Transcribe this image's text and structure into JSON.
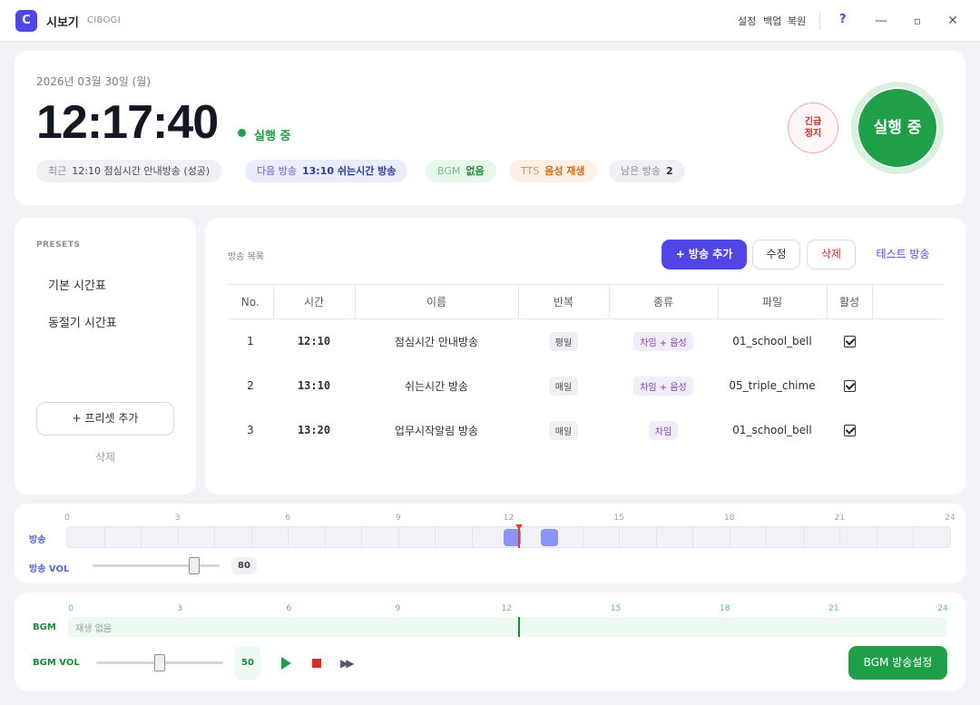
{
  "titlebar": {
    "logo_letter": "C",
    "app_name": "시보기",
    "app_sub": "CIBOGI",
    "menu": [
      "설정",
      "백업",
      "복원"
    ],
    "help": "?",
    "minimize": "—",
    "maximize": "▫",
    "close": "✕"
  },
  "status": {
    "date": "2026년 03월 30일 (월)",
    "clock": "12:17:40",
    "state": "실행 중",
    "chips": {
      "recent_key": "최근",
      "recent_val": "12:10 점심시간 안내방송 (성공)",
      "next_key": "다음 방송",
      "next_val": "13:10 쉬는시간 방송",
      "bgm_key": "BGM",
      "bgm_val": "없음",
      "tts_key": "TTS",
      "tts_val": "음성 재생",
      "remain_key": "남은 방송",
      "remain_val": "2"
    },
    "emergency_line1": "긴급",
    "emergency_line2": "정지",
    "run_button": "실행 중"
  },
  "presets": {
    "title": "PRESETS",
    "items": [
      "기본 시간표",
      "동절기 시간표"
    ],
    "add_label": "+ 프리셋 추가",
    "delete_label": "삭제"
  },
  "schedule": {
    "title": "방송 목록",
    "add_label": "+ 방송 추가",
    "edit_label": "수정",
    "delete_label": "삭제",
    "test_label": "테스트 방송",
    "columns": [
      "No.",
      "시간",
      "이름",
      "반복",
      "종류",
      "파일",
      "활성"
    ],
    "rows": [
      {
        "no": "1",
        "time": "12:10",
        "name": "점심시간 안내방송",
        "repeat": "평일",
        "type": "차임 + 음성",
        "file": "01_school_bell",
        "active": true
      },
      {
        "no": "2",
        "time": "13:10",
        "name": "쉬는시간 방송",
        "repeat": "매일",
        "type": "차임 + 음성",
        "file": "05_triple_chime",
        "active": true
      },
      {
        "no": "3",
        "time": "13:20",
        "name": "업무시작알림 방송",
        "repeat": "매일",
        "type": "차임",
        "file": "01_school_bell",
        "active": true
      }
    ]
  },
  "timeline": {
    "ticks": [
      "0",
      "3",
      "6",
      "9",
      "12",
      "15",
      "18",
      "21",
      "24"
    ],
    "broadcast_label": "방송",
    "vol_label": "방송 VOL",
    "vol_value": "80",
    "vol_fraction": 0.8,
    "current_hour": 12.29,
    "event_hours": [
      12.17,
      13.17
    ]
  },
  "bgm": {
    "ticks": [
      "0",
      "3",
      "6",
      "9",
      "12",
      "15",
      "18",
      "21",
      "24"
    ],
    "label": "BGM",
    "empty_text": "재생 없음",
    "vol_label": "BGM VOL",
    "vol_value": "50",
    "vol_fraction": 0.5,
    "play": "play-icon",
    "stop": "stop-icon",
    "forward": "fast-forward-icon",
    "forward_glyph": "▶▶",
    "setting_label": "BGM 방송설정"
  },
  "colors": {
    "accent": "#4f46e5",
    "run_green": "#1fa048",
    "danger": "#d32f2f"
  }
}
